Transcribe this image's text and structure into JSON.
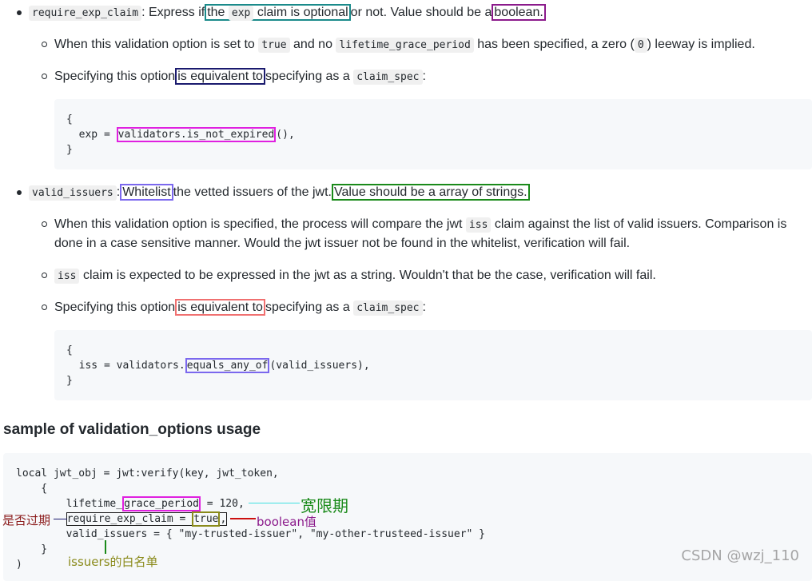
{
  "item1": {
    "name": "require_exp_claim",
    "t1": ": Express if",
    "box_the": "the",
    "code_exp": "exp",
    "box_claim": "claim is optional",
    "t2": "or not. Value should be a",
    "box_boolean": "boolean.",
    "sub1": {
      "t1": "When this validation option is set to",
      "code_true": "true",
      "t2": "and no",
      "code_grace": "lifetime_grace_period",
      "t3": "has been specified, a zero (",
      "code_zero": "0",
      "t4": ") leeway is implied."
    },
    "sub2": {
      "t1": "Specifying this option",
      "box_equiv": "is equivalent to",
      "t2": "specifying as a",
      "code_spec": "claim_spec",
      "t3": ":"
    },
    "code": {
      "l1": "{",
      "l2a": "  exp = ",
      "l2b": "validators.is_not_expired",
      "l2c": "(),",
      "l3": "}"
    }
  },
  "item2": {
    "name": "valid_issuers",
    "t1": ":",
    "box_whitelist": "Whitelist",
    "t2": "the vetted issuers of the jwt.",
    "box_value": "Value should be a array of strings.",
    "sub1": {
      "t1": "When this validation option is specified, the process will compare the jwt",
      "code_iss": "iss",
      "t2": "claim against the list of valid issuers. Comparison is",
      "line2": "done in a case sensitive manner. Would the jwt issuer not be found in the whitelist, verification will fail."
    },
    "sub2": {
      "code_iss": "iss",
      "t1": "claim is expected to be expressed in the jwt as a string. Wouldn't that be the case, verification will fail."
    },
    "sub3": {
      "t1": "Specifying this option",
      "box_equiv": "is equivalent to",
      "t2": "specifying as a",
      "code_spec": "claim_spec",
      "t3": ":"
    },
    "code": {
      "l1": "{",
      "l2a": "  iss = validators.",
      "l2b": "equals_any_of",
      "l2c": "(valid_issuers),",
      "l3": "}"
    }
  },
  "heading": "sample of validation_options usage",
  "sample": {
    "l1": "local jwt_obj = jwt:verify(key, jwt_token,",
    "l2": "    {",
    "l3a": "        lifetime_",
    "l3b": "grace_period",
    "l3c": " = 120,",
    "l4a": "require_exp_claim = ",
    "l4b": "true",
    "l4c": ",",
    "l5": "        valid_issuers = { \"my-trusted-issuer\", \"my-other-trusteed-issuer\" }",
    "l6": "    }",
    "l7": ")"
  },
  "annotations": {
    "kuanxianqi": "宽限期",
    "shifouguoqi": "是否过期",
    "boolean_zhi": "boolean值",
    "issuers_baimingdan": "issuers的白名单"
  },
  "watermark": "CSDN @wzj_110",
  "colors": {
    "teal": "#1a8a8a",
    "purple": "#8b1a8b",
    "navy": "#1a1a6e",
    "magenta": "#e020e0",
    "lavender": "#7b68ee",
    "green": "#1a8a1a",
    "salmon": "#f07070",
    "olive": "#8a8a1a",
    "red": "#cc1010",
    "cyan": "#40e0e0",
    "darkred": "#8b1a1a"
  }
}
